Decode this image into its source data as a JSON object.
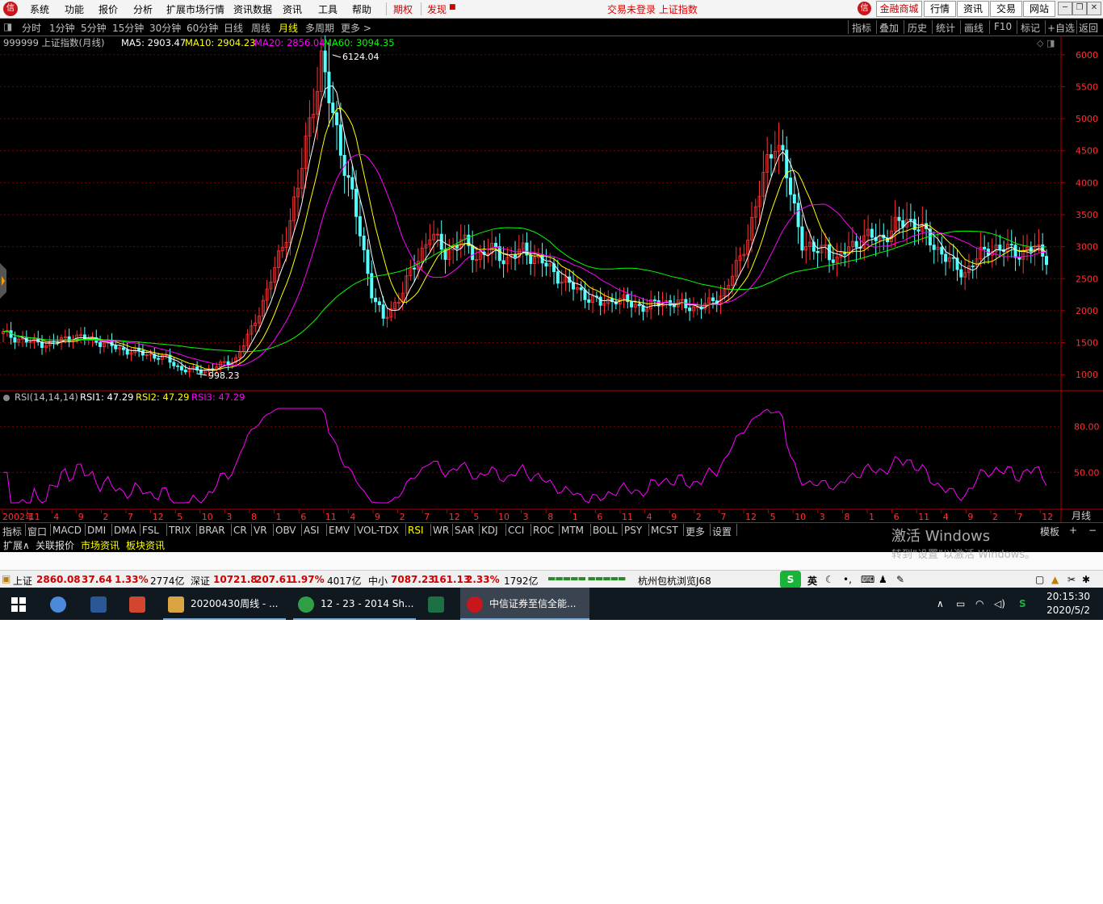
{
  "menubar": {
    "logo_text": "信",
    "items": [
      "系统",
      "功能",
      "报价",
      "分析",
      "扩展市场行情",
      "资讯数据",
      "资讯",
      "工具",
      "帮助"
    ],
    "items_red": [
      "期权",
      "发现"
    ],
    "status": "交易未登录  上证指数",
    "buttons": [
      "金融商城",
      "行情",
      "资讯",
      "交易",
      "网站"
    ]
  },
  "periodbar": {
    "periods": [
      "分时",
      "1分钟",
      "5分钟",
      "15分钟",
      "30分钟",
      "60分钟",
      "日线",
      "周线",
      "月线",
      "多周期",
      "更多 >"
    ],
    "active_index": 8,
    "tools": [
      "指标",
      "叠加",
      "历史",
      "统计",
      "画线",
      "F10",
      "标记",
      "+自选",
      "返回"
    ]
  },
  "main_chart": {
    "title": "999999 上证指数(月线)",
    "ma_labels": [
      {
        "text": "MA5: 2903.47",
        "color": "#ffffff"
      },
      {
        "text": "MA10: 2904.23",
        "color": "#ffff00"
      },
      {
        "text": "MA20: 2856.04",
        "color": "#ff00ff"
      },
      {
        "text": "MA60: 3094.35",
        "color": "#00ff00"
      }
    ],
    "high_label": "6124.04",
    "low_label": "998.23",
    "y_ticks": [
      "6000",
      "5500",
      "5000",
      "4500",
      "4000",
      "3500",
      "3000",
      "2500",
      "2000",
      "1500",
      "1000"
    ],
    "y_tick_values": [
      6000,
      5500,
      5000,
      4500,
      4000,
      3500,
      3000,
      2500,
      2000,
      1500,
      1000
    ]
  },
  "rsi_chart": {
    "title": "RSI(14,14,14)",
    "labels": [
      {
        "text": "RSI1: 47.29",
        "color": "#ffffff"
      },
      {
        "text": "RSI2: 47.29",
        "color": "#ffff00"
      },
      {
        "text": "RSI3: 47.29",
        "color": "#ff00ff"
      }
    ],
    "y_ticks": [
      "80.00",
      "50.00"
    ],
    "y_tick_values": [
      80,
      50
    ]
  },
  "x_axis": {
    "labels": [
      "2002年",
      "11",
      "4",
      "9",
      "2",
      "7",
      "12",
      "5",
      "10",
      "3",
      "8",
      "1",
      "6",
      "11",
      "4",
      "9",
      "2",
      "7",
      "12",
      "5",
      "10",
      "3",
      "8",
      "1",
      "6",
      "11",
      "4",
      "9",
      "2",
      "7",
      "12",
      "5",
      "10",
      "3",
      "8",
      "1",
      "6",
      "11",
      "4",
      "9",
      "2",
      "7",
      "12"
    ],
    "unit_label": "月线"
  },
  "indicator_tabs": {
    "items": [
      "指标",
      "窗口",
      "MACD",
      "DMI",
      "DMA",
      "FSL",
      "TRIX",
      "BRAR",
      "CR",
      "VR",
      "OBV",
      "ASI",
      "EMV",
      "VOL-TDX",
      "RSI",
      "WR",
      "SAR",
      "KDJ",
      "CCI",
      "ROC",
      "MTM",
      "BOLL",
      "PSY",
      "MCST",
      "更多",
      "设置"
    ],
    "active": "RSI",
    "right": [
      "模板",
      "+",
      "−"
    ]
  },
  "sub_tabs": {
    "items": [
      "扩展∧",
      "关联报价",
      "市场资讯",
      "板块资讯"
    ]
  },
  "watermark": {
    "line1": "激活 Windows",
    "line2": "转到\"设置\"以激活 Windows。"
  },
  "statusbar": {
    "sh_name": "上证",
    "sh_value": "2860.08",
    "sh_change": "37.64",
    "sh_pct": "1.33%",
    "sh_vol": "2774亿",
    "sz_name": "深证",
    "sz_value": "10721.8",
    "sz_change": "207.61",
    "sz_pct": "1.97%",
    "sz_vol": "4017亿",
    "zx_name": "中小",
    "zx_value": "7087.23",
    "zx_change": "161.13",
    "zx_pct": "2.33%",
    "zx_vol": "1792亿",
    "server": "杭州包杭浏览J68",
    "ime": "英"
  },
  "taskbar": {
    "tasks": [
      {
        "label": "20200430周线 - ...",
        "color": "#d9a441"
      },
      {
        "label": "12 - 23 - 2014 Sh...",
        "color": "#2f9e44"
      },
      {
        "label": "中信证券至信全能...",
        "color": "#c8161d"
      }
    ],
    "time": "20:15:30",
    "date": "2020/5/2"
  },
  "colors": {
    "ma5": "#ffffff",
    "ma10": "#ffff00",
    "ma20": "#ff00ff",
    "ma60": "#00ff00",
    "up": "#ff3232",
    "down": "#54ffff",
    "axis": "#b00000",
    "grid": "#7a0000"
  }
}
